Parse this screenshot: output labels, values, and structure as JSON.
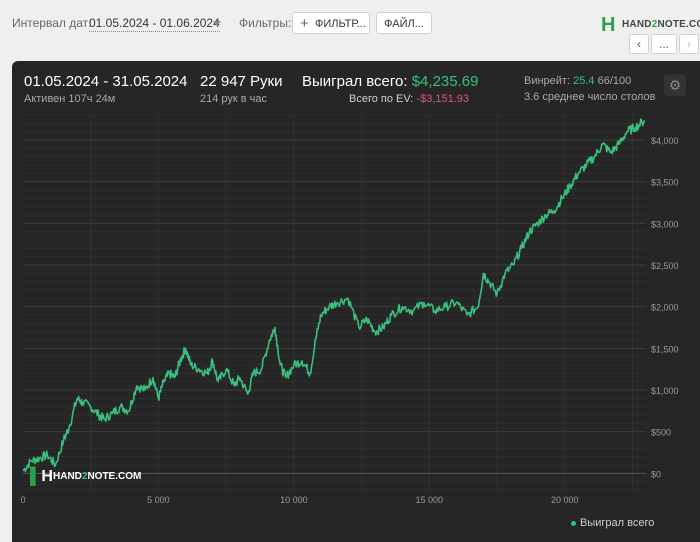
{
  "toolbar": {
    "date_label": "Интервал дат:",
    "date_range": "01.05.2024 - 01.06.2024",
    "filters_label": "Фильтры:",
    "filter_button": "ФИЛЬТР...",
    "files_button": "ФАЙЛ..."
  },
  "logo": {
    "prefix": "HAND",
    "two": "2",
    "suffix": "NOTE.COM"
  },
  "nav": {
    "prev": "‹",
    "more": "...",
    "next": "›"
  },
  "stats": {
    "period": "01.05.2024 - 31.05.2024",
    "active": "Активен 107ч 24м",
    "hands": "22 947 Руки",
    "hands_per_hour": "214 рук в час",
    "won_label": "Выиграл всего:",
    "won_value": "$4,235.69",
    "ev_label": "Всего по EV:",
    "ev_value": "-$3,151.93",
    "winrate_label": "Винрейт:",
    "winrate_value": "25.4",
    "winrate_suffix": "66/100",
    "tables": "3.6 среднее число столов"
  },
  "watermark": {
    "prefix": "HAND",
    "two": "2",
    "suffix": "NOTE.COM"
  },
  "colors": {
    "line": "#38c07c",
    "panel": "#262626",
    "accent": "#2e9e4a",
    "negative": "#e0557a"
  },
  "chart_data": {
    "type": "line",
    "xlim": [
      0,
      23000
    ],
    "ylim": [
      -200,
      4300
    ],
    "x_ticks": [
      0,
      5000,
      10000,
      15000,
      20000
    ],
    "x_tick_labels": [
      "0",
      "5 000",
      "10 000",
      "15 000",
      "20 000"
    ],
    "y_ticks": [
      0,
      500,
      1000,
      1500,
      2000,
      2500,
      3000,
      3500,
      4000
    ],
    "y_tick_labels": [
      "$0",
      "$500",
      "$1,000",
      "$1,500",
      "$2,000",
      "$2,500",
      "$3,000",
      "$3,500",
      "$4,000"
    ],
    "grid": true,
    "legend_position": "bottom-right",
    "series": [
      {
        "name": "Выиграл всего",
        "x": [
          0,
          300,
          600,
          900,
          1200,
          1500,
          1700,
          2000,
          2200,
          2500,
          2800,
          3000,
          3300,
          3600,
          3900,
          4200,
          4500,
          4800,
          5000,
          5200,
          5400,
          5600,
          5800,
          6000,
          6200,
          6500,
          6800,
          7000,
          7200,
          7500,
          7800,
          8000,
          8300,
          8500,
          8800,
          9100,
          9300,
          9500,
          9700,
          10000,
          10300,
          10600,
          10800,
          11000,
          11300,
          11600,
          12000,
          12400,
          12700,
          13000,
          13300,
          13600,
          14000,
          14400,
          14800,
          15200,
          15600,
          16000,
          16400,
          16800,
          17000,
          17200,
          17500,
          17800,
          18100,
          18400,
          18700,
          19000,
          19300,
          19600,
          19900,
          20200,
          20500,
          20800,
          21100,
          21400,
          21700,
          22000,
          22300,
          22600,
          22947
        ],
        "values": [
          30,
          150,
          180,
          220,
          100,
          400,
          550,
          900,
          850,
          800,
          700,
          650,
          720,
          800,
          750,
          1050,
          1000,
          1150,
          900,
          1100,
          1200,
          1150,
          1350,
          1500,
          1300,
          1250,
          1200,
          1350,
          1100,
          1250,
          1050,
          1150,
          950,
          1200,
          1250,
          1600,
          1750,
          1300,
          1150,
          1300,
          1350,
          1200,
          1600,
          1900,
          2000,
          2050,
          2100,
          1750,
          1850,
          1700,
          1750,
          1900,
          2000,
          1950,
          2050,
          1950,
          2000,
          2050,
          1900,
          2000,
          2400,
          2300,
          2150,
          2400,
          2500,
          2700,
          2900,
          3000,
          3100,
          3150,
          3300,
          3450,
          3600,
          3700,
          3800,
          3950,
          3850,
          3950,
          4100,
          4150,
          4235
        ]
      }
    ]
  }
}
